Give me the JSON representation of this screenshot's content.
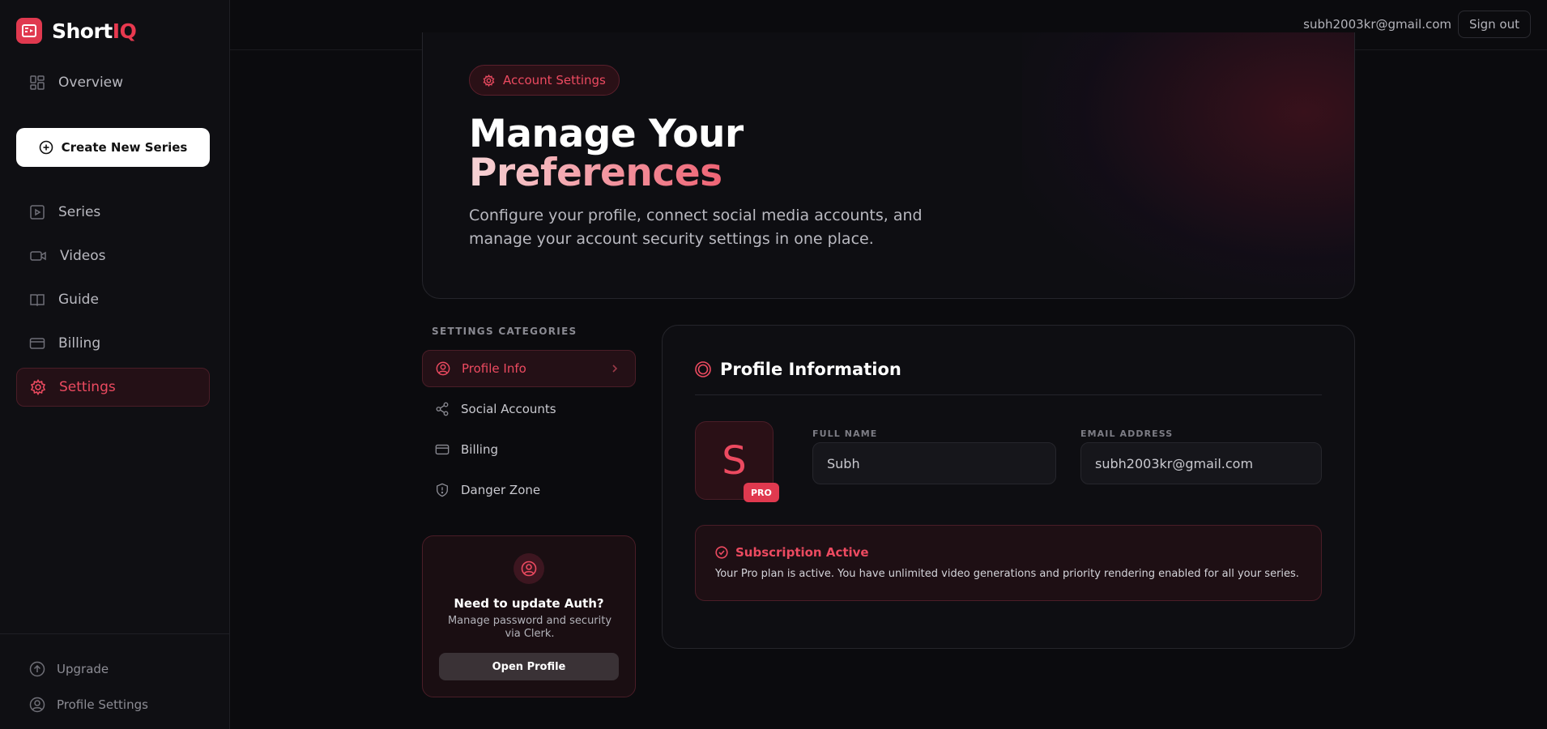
{
  "brand": {
    "name_main": "Short",
    "name_accent": "IQ",
    "accent_color": "#e0394f"
  },
  "sidebar": {
    "overview_label": "Overview",
    "create_label": "Create New Series",
    "items": [
      {
        "label": "Series",
        "icon": "play-square-icon"
      },
      {
        "label": "Videos",
        "icon": "video-camera-icon"
      },
      {
        "label": "Guide",
        "icon": "book-icon"
      },
      {
        "label": "Billing",
        "icon": "credit-card-icon"
      },
      {
        "label": "Settings",
        "icon": "gear-icon",
        "active": true
      }
    ],
    "bottom": {
      "upgrade_label": "Upgrade",
      "profile_label": "Profile Settings"
    }
  },
  "header": {
    "email": "subh2003kr@gmail.com",
    "signout_label": "Sign out"
  },
  "hero": {
    "tag": "Account Settings",
    "title_line1": "Manage Your",
    "title_line2": "Preferences",
    "description": "Configure your profile, connect social media accounts, and manage your account security settings in one place."
  },
  "categories": {
    "header": "SETTINGS CATEGORIES",
    "items": [
      {
        "label": "Profile Info",
        "icon": "user-circle-icon",
        "active": true
      },
      {
        "label": "Social Accounts",
        "icon": "share-icon"
      },
      {
        "label": "Billing",
        "icon": "credit-card-icon"
      },
      {
        "label": "Danger Zone",
        "icon": "shield-alert-icon"
      }
    ]
  },
  "auth_card": {
    "title": "Need to update Auth?",
    "subtitle": "Manage password and security via Clerk.",
    "button_label": "Open Profile"
  },
  "profile": {
    "title": "Profile Information",
    "avatar_letter": "S",
    "badge": "PRO",
    "full_name_label": "FULL NAME",
    "full_name_value": "Subh",
    "email_label": "EMAIL ADDRESS",
    "email_value": "subh2003kr@gmail.com",
    "subscription_title": "Subscription Active",
    "subscription_text": "Your Pro plan is active. You have unlimited video generations and priority rendering enabled for all your series."
  }
}
